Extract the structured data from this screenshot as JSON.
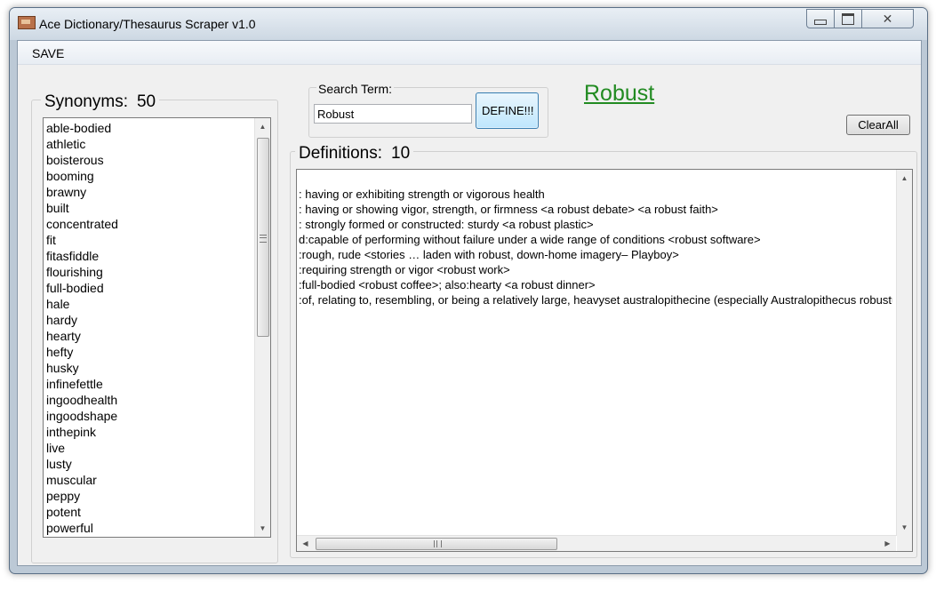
{
  "window": {
    "title": "Ace Dictionary/Thesaurus Scraper v1.0"
  },
  "menu": {
    "save": "SAVE"
  },
  "synonyms": {
    "label": "Synonyms:",
    "count": "50",
    "items": [
      "able-bodied",
      "athletic",
      "boisterous",
      "booming",
      "brawny",
      "built",
      "concentrated",
      "fit",
      "fitasfiddle",
      "flourishing",
      "full-bodied",
      "hale",
      "hardy",
      "hearty",
      "hefty",
      "husky",
      "infinefettle",
      "ingoodhealth",
      "ingoodshape",
      "inthepink",
      "live",
      "lusty",
      "muscular",
      "peppy",
      "potent",
      "powerful"
    ]
  },
  "search": {
    "label": "Search Term:",
    "value": "Robust",
    "define_button": "DEFINE!!!"
  },
  "word_link": "Robust",
  "clear_button": "ClearAll",
  "definitions": {
    "label": "Definitions:",
    "count": "10",
    "lines": [
      ": having or exhibiting strength or vigorous health",
      ": having or showing vigor, strength, or firmness <a robust debate> <a robust faith>",
      ": strongly formed or constructed: sturdy <a robust plastic>",
      "d:capable of performing without failure under a wide range of conditions <robust software>",
      ":rough, rude <stories … laden with robust, down-home imagery– Playboy>",
      ":requiring strength or vigor <robust work>",
      ":full-bodied <robust coffee>; also:hearty <a robust dinner>",
      ":of, relating to, resembling, or being a relatively large, heavyset australopithecine (especially Australopithecus robustus)"
    ]
  },
  "icons": {
    "app": "app-icon",
    "minimize": "minimize-icon",
    "maximize": "maximize-icon",
    "close": "close-icon",
    "scroll_up": "scroll-up-arrow-icon",
    "scroll_down": "scroll-down-arrow-icon",
    "scroll_left": "scroll-left-arrow-icon",
    "scroll_right": "scroll-right-arrow-icon"
  },
  "colors": {
    "link": "#228b22",
    "button_focus": "#3c7fb1"
  }
}
